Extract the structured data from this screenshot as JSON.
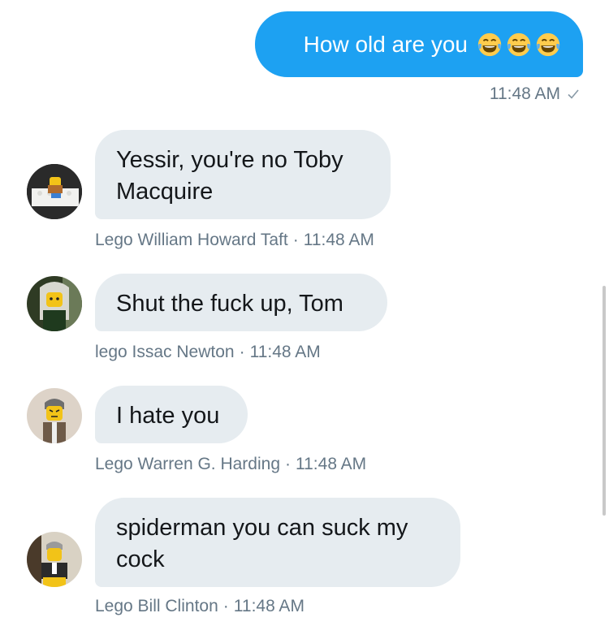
{
  "outgoing": {
    "text": "How old are you",
    "emojis": [
      "laughing-tears-emoji",
      "laughing-tears-emoji",
      "laughing-tears-emoji"
    ],
    "time": "11:48 AM",
    "status_icon": "checkmark-icon",
    "bubble_color": "#1da1f2"
  },
  "messages": [
    {
      "sender": "Lego William Howard Taft",
      "time": "11:48 AM",
      "lines": [
        "Yessir, you're no Toby",
        "Macquire"
      ]
    },
    {
      "sender": "lego Issac Newton",
      "time": "11:48 AM",
      "lines": [
        "Shut the fuck up, Tom"
      ]
    },
    {
      "sender": "Lego Warren G. Harding",
      "time": "11:48 AM",
      "lines": [
        "I hate you"
      ]
    },
    {
      "sender": "Lego Bill Clinton",
      "time": "11:48 AM",
      "lines": [
        "spiderman you can suck my",
        "cock"
      ]
    }
  ],
  "meta": {
    "separator": "·"
  },
  "colors": {
    "incoming_bubble": "#e6ecf0",
    "meta_text": "#657786",
    "text": "#14171a"
  }
}
